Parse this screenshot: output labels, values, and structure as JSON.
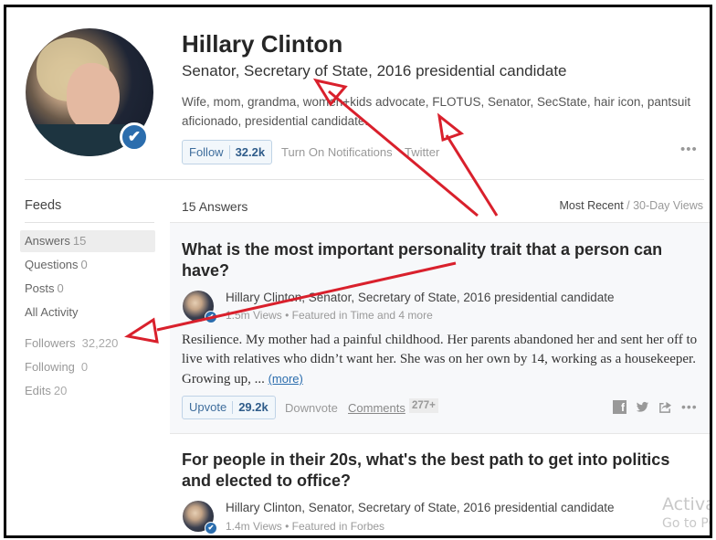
{
  "profile": {
    "name": "Hillary Clinton",
    "credential": "Senator, Secretary of State, 2016 presidential candidate",
    "bio": "Wife, mom, grandma, women+kids advocate, FLOTUS, Senator, SecState, hair icon, pantsuit aficionado, presidential candidate.",
    "follow_label": "Follow",
    "follow_count": "32.2k",
    "notifications_label": "Turn On Notifications",
    "twitter_label": "Twitter",
    "more_label": "•••",
    "verified_icon": "checkmark-icon"
  },
  "sidebar": {
    "title": "Feeds",
    "items": [
      {
        "label": "Answers",
        "count": "15"
      },
      {
        "label": "Questions",
        "count": "0"
      },
      {
        "label": "Posts",
        "count": "0"
      },
      {
        "label": "All Activity",
        "count": ""
      },
      {
        "label": "Followers",
        "count": "32,220"
      },
      {
        "label": "Following",
        "count": "0"
      },
      {
        "label": "Edits",
        "count": "20"
      }
    ]
  },
  "answers_header": {
    "count_label": "15 Answers",
    "sort_active": "Most Recent",
    "sort_sep": " / ",
    "sort_alt": "30-Day Views"
  },
  "answers": [
    {
      "question": "What is the most important personality trait that a person can have?",
      "author": "Hillary Clinton, Senator, Secretary of State, 2016 presidential candidate",
      "meta": "1.5m Views • Featured in Time and 4 more",
      "text": "Resilience. My mother had a painful childhood. Her parents abandoned her and sent her off to live with relatives who didn’t want her. She was on her own by 14, working as a housekeeper. Growing up, ... ",
      "more_link": "(more)",
      "upvote_label": "Upvote",
      "upvote_count": "29.2k",
      "downvote_label": "Downvote",
      "comments_label": "Comments",
      "comments_count": "277+",
      "share_icons": [
        "facebook-icon",
        "twitter-icon",
        "share-icon"
      ],
      "more_label": "•••"
    },
    {
      "question": "For people in their 20s, what's the best path to get into politics and elected to office?",
      "author": "Hillary Clinton, Senator, Secretary of State, 2016 presidential candidate",
      "meta": "1.4m Views • Featured in Forbes"
    }
  ],
  "watermark": {
    "line1": "Activat",
    "line2": "Go to PC"
  },
  "annotation": {
    "arrow_color": "#d9202c"
  }
}
